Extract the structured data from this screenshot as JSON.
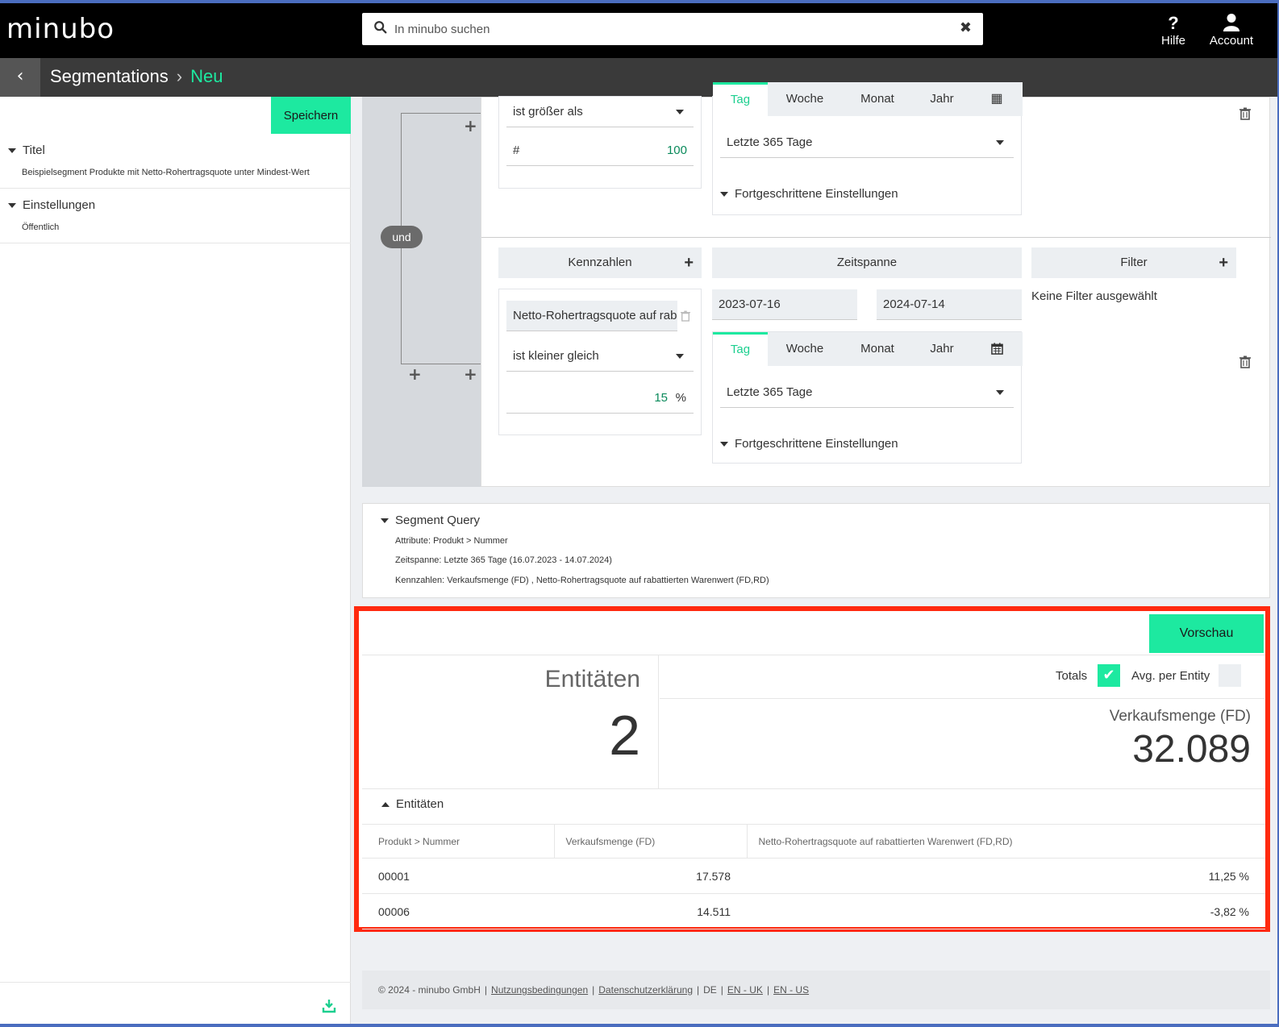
{
  "app": {
    "logo": "minubo"
  },
  "topbar": {
    "search_placeholder": "In minubo suchen",
    "help_label": "Hilfe",
    "help_glyph": "?",
    "account_label": "Account"
  },
  "breadcrumb": {
    "back": "‹",
    "parent": "Segmentations",
    "separator": "›",
    "current": "Neu"
  },
  "left": {
    "save_label": "Speichern",
    "sections": [
      {
        "title": "Titel",
        "value": "Beispielsegment Produkte mit Netto-Rohertragsquote unter Mindest-Wert"
      },
      {
        "title": "Einstellungen",
        "value": "Öffentlich"
      }
    ]
  },
  "builder": {
    "and_label": "und",
    "rule1": {
      "operator": "ist größer als",
      "prefix": "#",
      "value": "100",
      "tabs": [
        "Tag",
        "Woche",
        "Monat",
        "Jahr"
      ],
      "period": "Letzte 365 Tage",
      "advanced": "Fortgeschrittene Einstellungen"
    },
    "rule2": {
      "kennzahlen_header": "Kennzahlen",
      "zeitspanne_header": "Zeitspanne",
      "filter_header": "Filter",
      "metric": "Netto-Rohertragsquote auf rabattierten Warenwert (FD,RD)",
      "operator": "ist kleiner gleich",
      "value": "15",
      "unit": "%",
      "date_from": "2023-07-16",
      "date_to": "2024-07-14",
      "tabs": [
        "Tag",
        "Woche",
        "Monat",
        "Jahr"
      ],
      "period": "Letzte 365 Tage",
      "advanced": "Fortgeschrittene Einstellungen",
      "no_filter": "Keine Filter ausgewählt"
    }
  },
  "segment_query": {
    "title": "Segment Query",
    "lines": [
      "Attribute:  Produkt > Nummer",
      "Zeitspanne:  Letzte 365 Tage (16.07.2023 - 14.07.2024)",
      "Kennzahlen:  Verkaufsmenge (FD) , Netto-Rohertragsquote auf rabattierten Warenwert (FD,RD)"
    ]
  },
  "results": {
    "preview_label": "Vorschau",
    "entities_label": "Entitäten",
    "entities_count": "2",
    "totals_label": "Totals",
    "totals_checked": true,
    "avg_label": "Avg. per Entity",
    "avg_checked": false,
    "kpi_label": "Verkaufsmenge (FD)",
    "kpi_value": "32.089",
    "table_title": "Entitäten",
    "columns": [
      "Produkt > Nummer",
      "Verkaufsmenge (FD)",
      "Netto-Rohertragsquote auf rabattierten Warenwert (FD,RD)"
    ],
    "rows": [
      [
        "00001",
        "17.578",
        "11,25 %"
      ],
      [
        "00006",
        "14.511",
        "-3,82 %"
      ]
    ]
  },
  "footer": {
    "copyright": "© 2024 - minubo GmbH",
    "terms": "Nutzungsbedingungen",
    "privacy": "Datenschutzerklärung",
    "lang_de": "DE",
    "lang_uk": "EN - UK",
    "lang_us": "EN - US",
    "sep": "|"
  },
  "colors": {
    "accent": "#1de9a0",
    "highlight": "#ff2a0f",
    "topbar": "#000000",
    "subbar": "#3a3a3a"
  }
}
